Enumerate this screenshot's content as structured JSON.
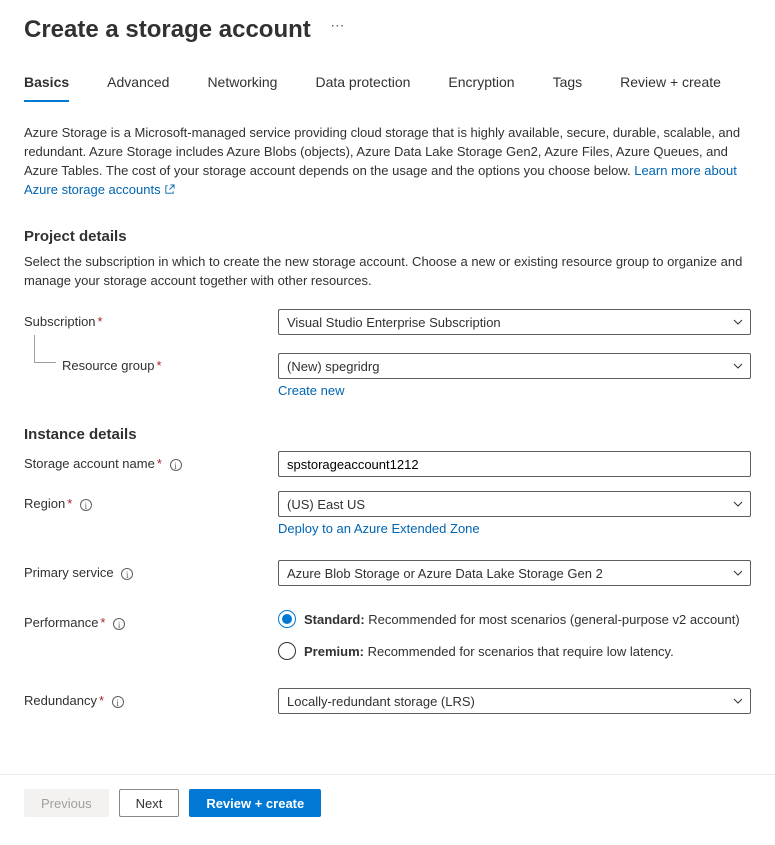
{
  "header": {
    "title": "Create a storage account",
    "ellipsis": "⋯"
  },
  "tabs": {
    "items": [
      {
        "label": "Basics",
        "active": true
      },
      {
        "label": "Advanced",
        "active": false
      },
      {
        "label": "Networking",
        "active": false
      },
      {
        "label": "Data protection",
        "active": false
      },
      {
        "label": "Encryption",
        "active": false
      },
      {
        "label": "Tags",
        "active": false
      },
      {
        "label": "Review + create",
        "active": false
      }
    ]
  },
  "intro": {
    "text": "Azure Storage is a Microsoft-managed service providing cloud storage that is highly available, secure, durable, scalable, and redundant. Azure Storage includes Azure Blobs (objects), Azure Data Lake Storage Gen2, Azure Files, Azure Queues, and Azure Tables. The cost of your storage account depends on the usage and the options you choose below. ",
    "link_text": "Learn more about Azure storage accounts"
  },
  "project": {
    "heading": "Project details",
    "desc": "Select the subscription in which to create the new storage account. Choose a new or existing resource group to organize and manage your storage account together with other resources.",
    "subscription_label": "Subscription",
    "subscription_value": "Visual Studio Enterprise Subscription",
    "rg_label": "Resource group",
    "rg_value": "(New) spegridrg",
    "create_new": "Create new"
  },
  "instance": {
    "heading": "Instance details",
    "name_label": "Storage account name",
    "name_value": "spstorageaccount1212",
    "region_label": "Region",
    "region_value": "(US) East US",
    "deploy_link": "Deploy to an Azure Extended Zone",
    "primary_label": "Primary service",
    "primary_value": "Azure Blob Storage or Azure Data Lake Storage Gen 2",
    "perf_label": "Performance",
    "perf_standard_b": "Standard:",
    "perf_standard_t": " Recommended for most scenarios (general-purpose v2 account)",
    "perf_premium_b": "Premium:",
    "perf_premium_t": " Recommended for scenarios that require low latency.",
    "redundancy_label": "Redundancy",
    "redundancy_value": "Locally-redundant storage (LRS)"
  },
  "footer": {
    "previous": "Previous",
    "next": "Next",
    "review": "Review + create"
  }
}
